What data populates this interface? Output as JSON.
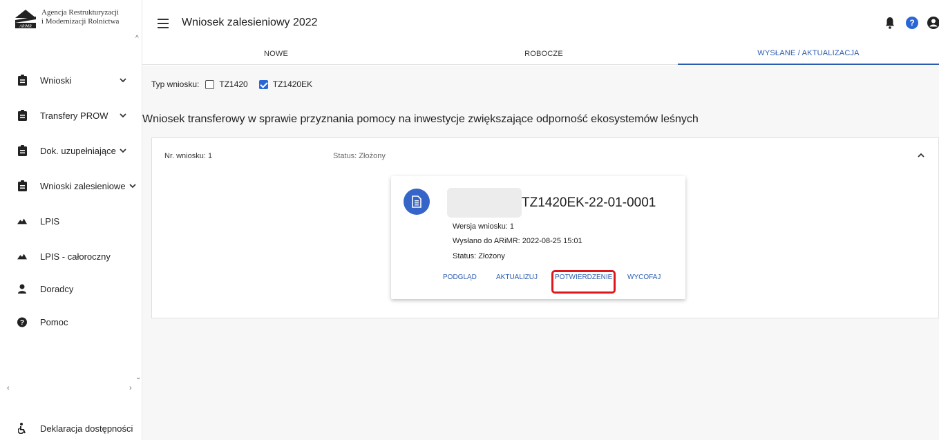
{
  "logo": {
    "line1": "Agencja Restrukturyzacji",
    "line2": "i Modernizacji Rolnictwa",
    "mark_text": "ARiMR"
  },
  "sidebar": {
    "items": [
      {
        "label": "Wnioski",
        "icon": "clipboard-icon",
        "has_chevron": true
      },
      {
        "label": "Transfery PROW",
        "icon": "clipboard-icon",
        "has_chevron": true
      },
      {
        "label": "Dok. uzupełniające",
        "icon": "clipboard-icon",
        "has_chevron": true
      },
      {
        "label": "Wnioski zalesieniowe",
        "icon": "clipboard-icon",
        "has_chevron": true
      },
      {
        "label": "LPIS",
        "icon": "terrain-icon",
        "has_chevron": false
      },
      {
        "label": "LPIS - całoroczny",
        "icon": "terrain-icon",
        "has_chevron": false
      },
      {
        "label": "Doradcy",
        "icon": "person-icon",
        "has_chevron": false
      },
      {
        "label": "Pomoc",
        "icon": "help-circle-icon",
        "has_chevron": false
      }
    ],
    "accessibility_label": "Deklaracja dostępności"
  },
  "header": {
    "title": "Wniosek zalesieniowy 2022",
    "help_glyph": "?"
  },
  "tabs": [
    {
      "label": "NOWE",
      "active": false
    },
    {
      "label": "ROBOCZE",
      "active": false
    },
    {
      "label": "WYSŁANE / AKTUALIZACJA",
      "active": true
    }
  ],
  "filter": {
    "label": "Typ wniosku:",
    "options": [
      {
        "label": "TZ1420",
        "checked": false
      },
      {
        "label": "TZ1420EK",
        "checked": true
      }
    ]
  },
  "section": {
    "title": "Wniosek transferowy w sprawie przyznania pomocy na inwestycje zwiększające odporność ekosystemów leśnych"
  },
  "panel": {
    "nr": "Nr. wniosku: 1",
    "status": "Status: Złożony"
  },
  "card": {
    "title": "TZ1420EK-22-01-0001",
    "version": "Wersja wniosku: 1",
    "sent": "Wysłano do ARiMR: 2022-08-25 15:01",
    "status": "Status: Złożony",
    "actions": {
      "preview": "PODGLĄD",
      "update": "AKTUALIZUJ",
      "confirmation": "POTWIERDZENIE",
      "withdraw": "WYCOFAJ"
    }
  },
  "colors": {
    "accent": "#2a5db0",
    "avatar": "#3565c8",
    "highlight": "#e0161d"
  }
}
